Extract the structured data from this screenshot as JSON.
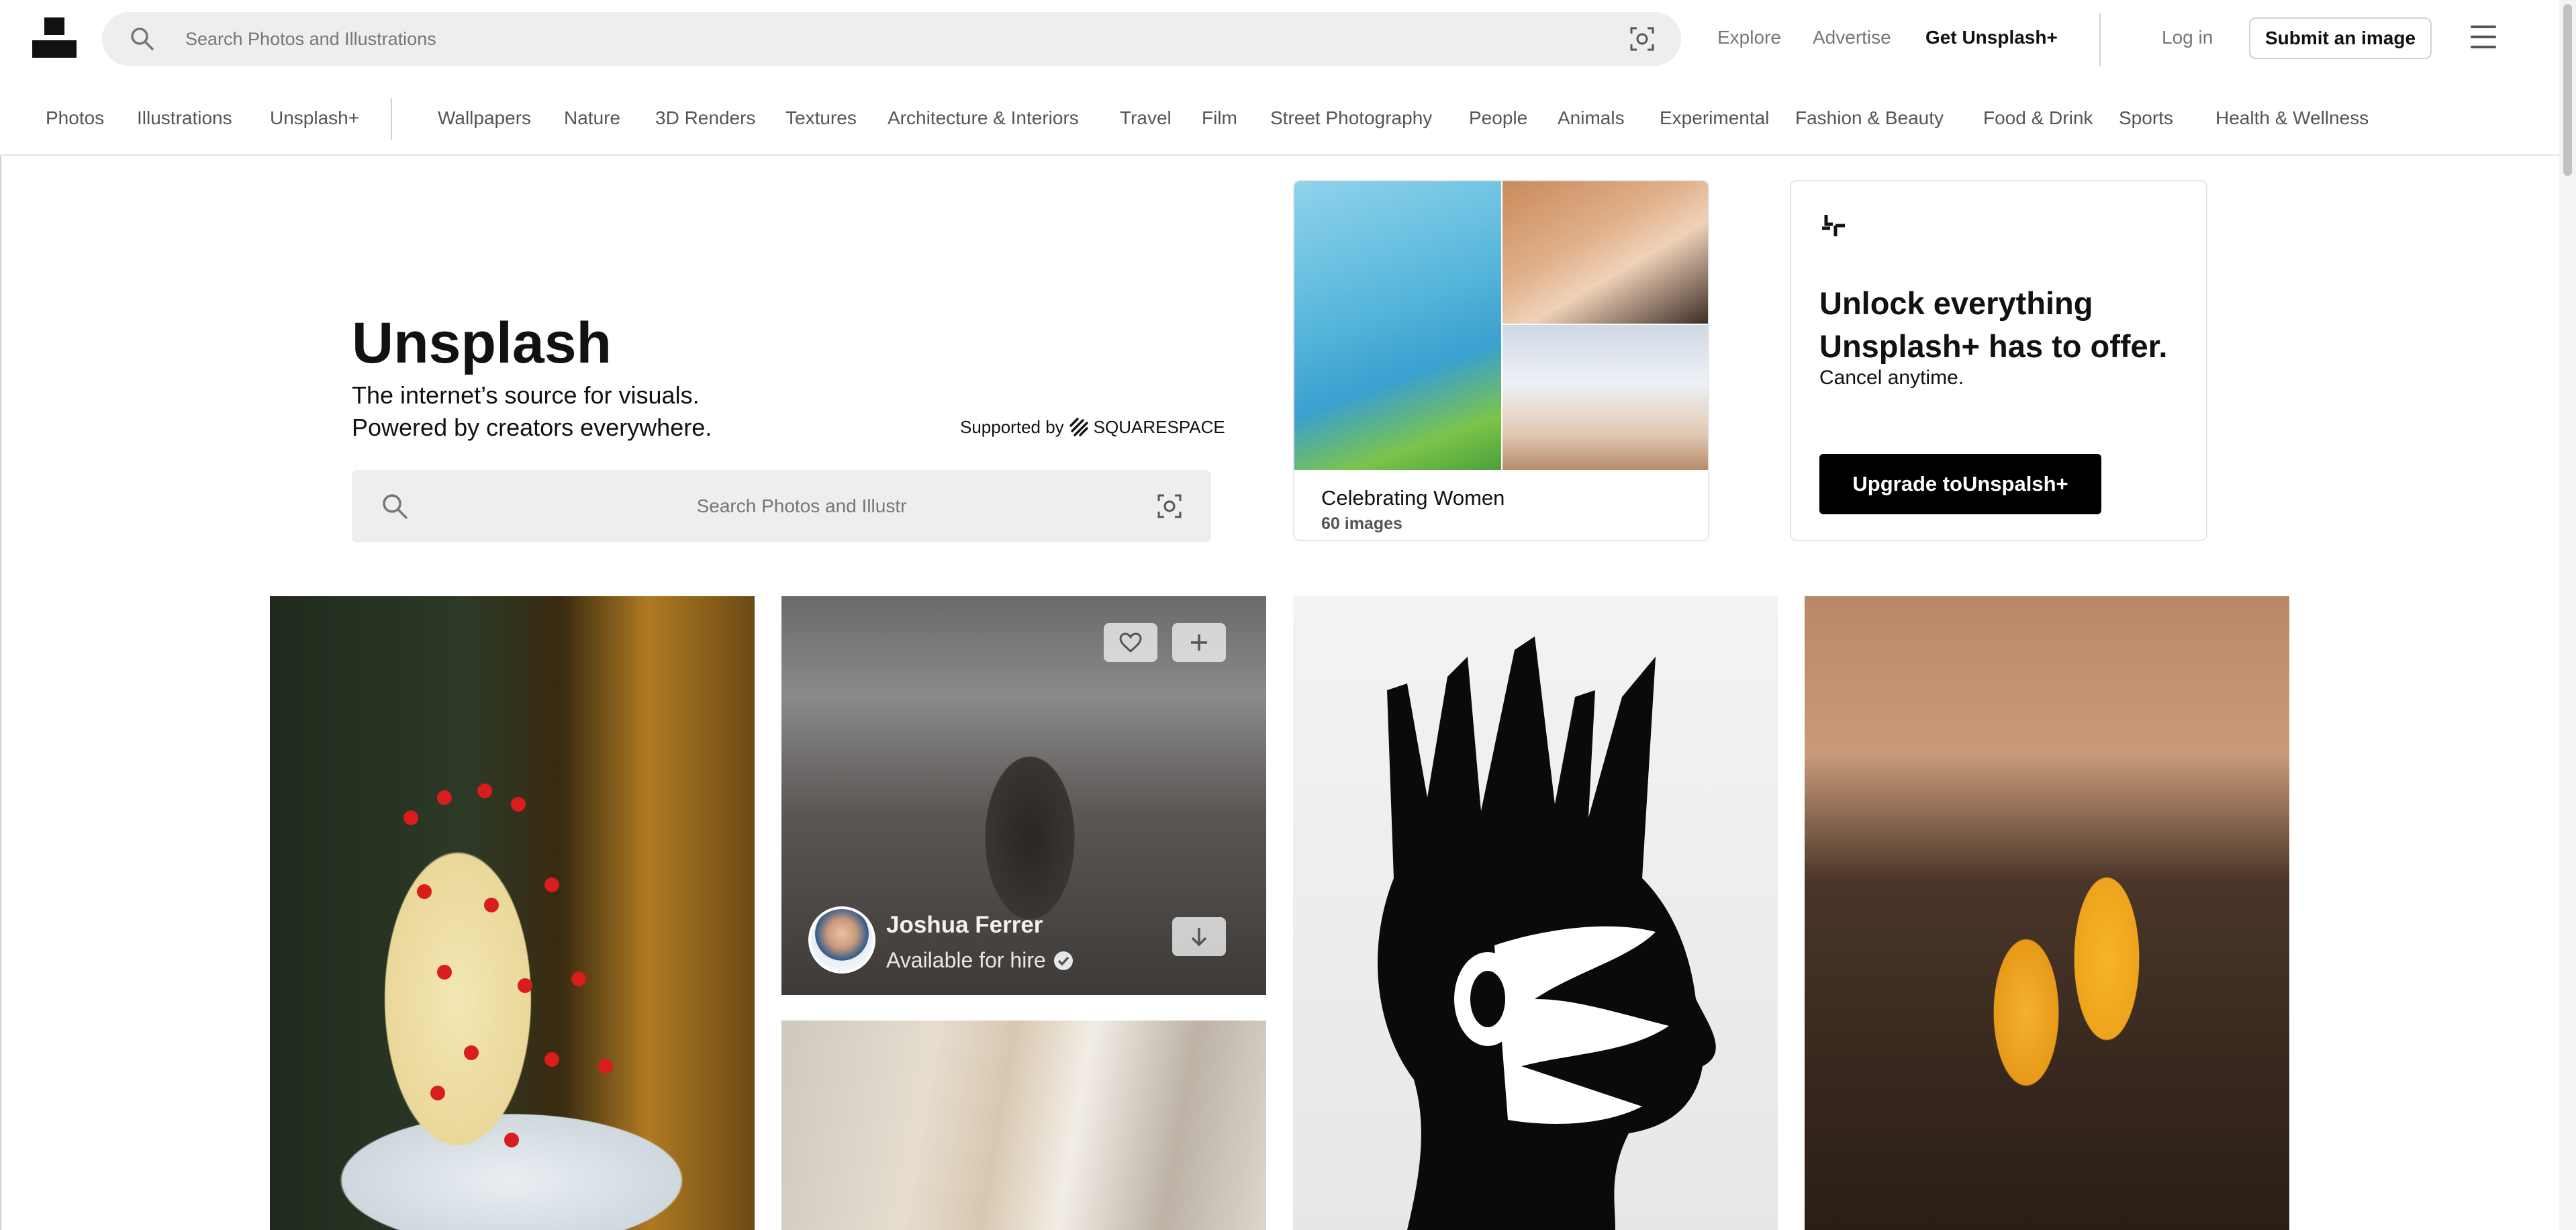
{
  "header": {
    "search_placeholder": "Search Photos and Illustrations",
    "nav": {
      "explore": "Explore",
      "advertise": "Advertise",
      "get_plus": "Get Unsplash+",
      "login": "Log in",
      "submit": "Submit an image"
    }
  },
  "categories": {
    "primary": [
      "Photos",
      "Illustrations",
      "Unsplash+"
    ],
    "topics": [
      "Wallpapers",
      "Nature",
      "3D Renders",
      "Textures",
      "Architecture & Interiors",
      "Travel",
      "Film",
      "Street Photography",
      "People",
      "Animals",
      "Experimental",
      "Fashion & Beauty",
      "Food & Drink",
      "Sports",
      "Health & Wellness"
    ]
  },
  "hero": {
    "title": "Unsplash",
    "subtitle_line1": "The internet’s source for visuals.",
    "subtitle_line2": "Powered by creators everywhere.",
    "supported_by": "Supported by",
    "sponsor": "SQUARESPACE",
    "search_placeholder": "Search Photos and Illustr"
  },
  "collection": {
    "title": "Celebrating Women",
    "count": "60 images"
  },
  "plus_card": {
    "headline": "Unlock everything Unsplash+ has to offer.",
    "subtext": "Cancel anytime.",
    "button": "Upgrade toUnspalsh+"
  },
  "hovered_photo": {
    "author": "Joshua Ferrer",
    "status": "Available for hire"
  },
  "icons": {
    "logo": "unsplash-logo",
    "search": "search-icon",
    "visual_search": "visual-search-icon",
    "menu": "hamburger-menu-icon",
    "like": "heart-icon",
    "add": "plus-icon",
    "download": "arrow-down-icon",
    "verified": "check-circle-icon"
  }
}
